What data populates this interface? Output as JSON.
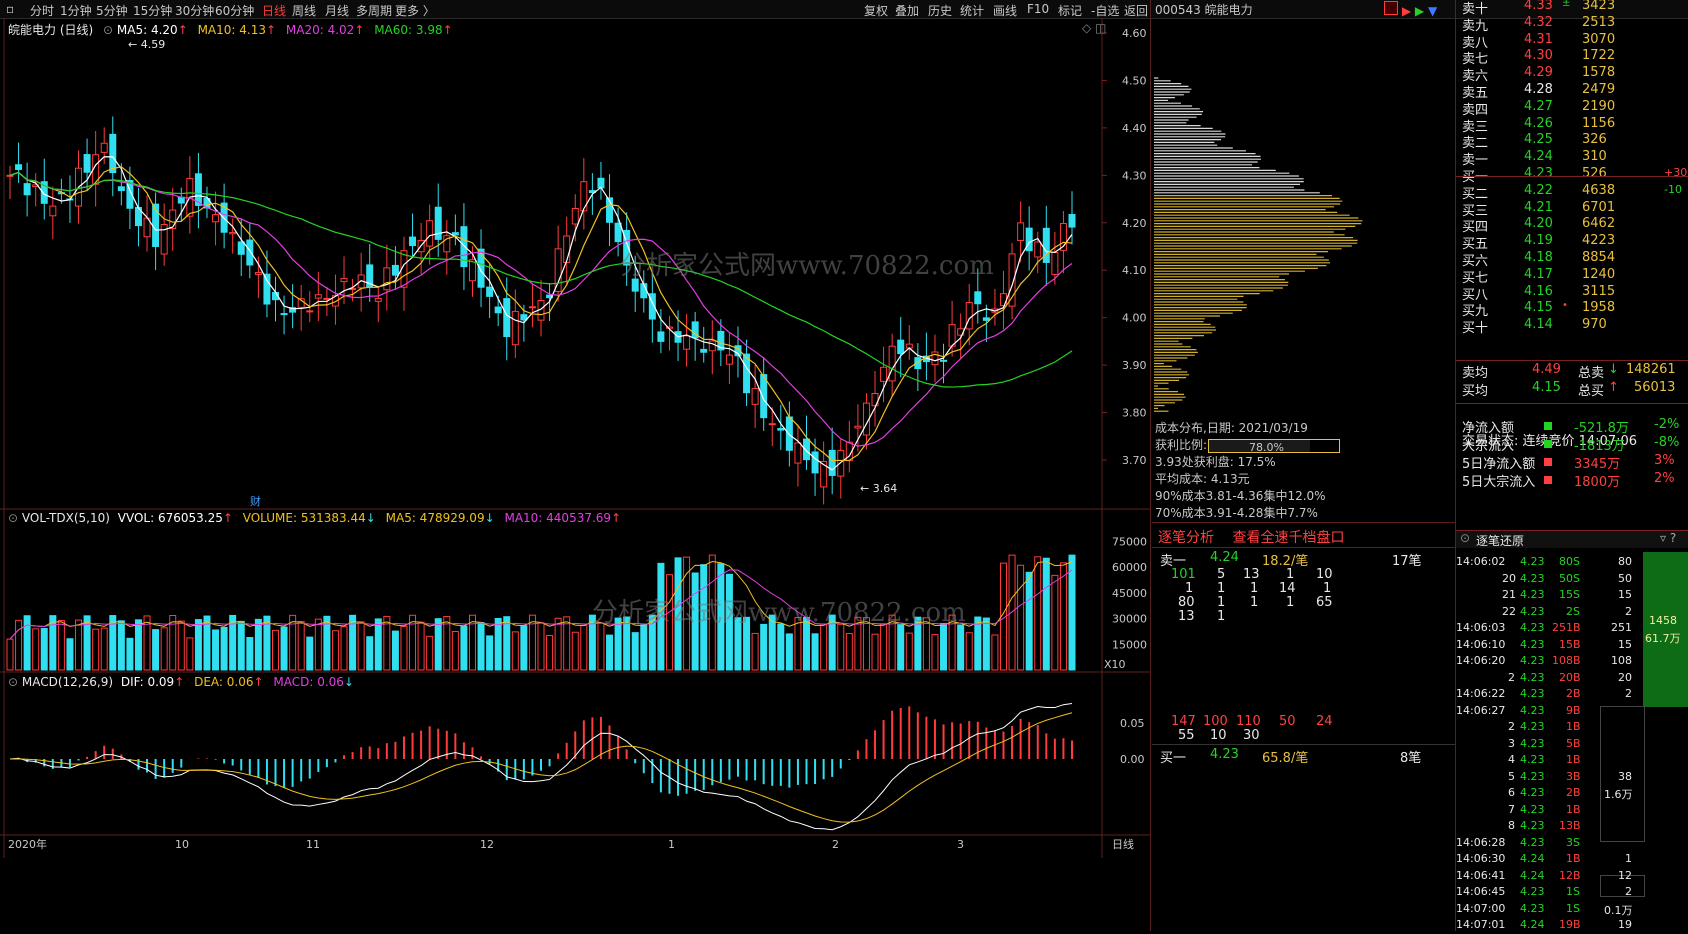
{
  "toolbar": {
    "periods": [
      "分时",
      "1分钟",
      "5分钟",
      "15分钟",
      "30分钟",
      "60分钟",
      "日线",
      "周线",
      "月线",
      "多周期",
      "更多 〉"
    ],
    "active_period": "日线",
    "right_items": [
      "复权",
      "叠加",
      "历史",
      "统计",
      "画线",
      "F10",
      "标记",
      "-自选",
      "返回"
    ]
  },
  "stock": {
    "code": "000543",
    "name": "皖能电力",
    "title": "皖能电力 (日线)"
  },
  "main_indicators": {
    "ma5": "MA5: 4.20",
    "ma10": "MA10: 4.13",
    "ma20": "MA20: 4.02",
    "ma60": "MA60: 3.98",
    "colors": {
      "ma5": "#ffffff",
      "ma10": "#f0c020",
      "ma20": "#e040e0",
      "ma60": "#24d324"
    }
  },
  "price_axis": [
    "4.60",
    "4.50",
    "4.40",
    "4.30",
    "4.20",
    "4.10",
    "4.00",
    "3.90",
    "3.80",
    "3.70"
  ],
  "price_annotations": {
    "high": "4.59",
    "low": "3.64",
    "finance_mark": "财"
  },
  "volume_indicators": {
    "name": "VOL-TDX(5,10)",
    "vvol": "VVOL: 676053.25",
    "volume": "VOLUME: 531383.44",
    "ma5": "MA5: 478929.09",
    "ma10": "MA10: 440537.69"
  },
  "volume_axis": [
    "75000",
    "60000",
    "45000",
    "30000",
    "15000"
  ],
  "volume_unit": "X10",
  "macd_indicators": {
    "name": "MACD(12,26,9)",
    "dif": "DIF: 0.09",
    "dea": "DEA: 0.06",
    "macd": "MACD: 0.06"
  },
  "macd_axis": [
    "0.05",
    "0.00"
  ],
  "date_axis": [
    "2020年",
    "10",
    "11",
    "12",
    "1",
    "2",
    "3"
  ],
  "period_label": "日线",
  "watermark": "分析家公式网www.70822.com",
  "chip": {
    "date_line": "成本分布,日期: 2021/03/19",
    "profit_label": "获利比例:",
    "profit_value": "78.0%",
    "profit_ratio": 0.78,
    "line2": "3.93处获利盘: 17.5%",
    "line3": "平均成本: 4.13元",
    "line4": "90%成本3.81-4.36集中12.0%",
    "line5": "70%成本3.91-4.28集中7.7%"
  },
  "order_book": {
    "sells": [
      {
        "label": "卖十",
        "price": "4.33",
        "vol": "3423",
        "mark": "±"
      },
      {
        "label": "卖九",
        "price": "4.32",
        "vol": "2513"
      },
      {
        "label": "卖八",
        "price": "4.31",
        "vol": "3070"
      },
      {
        "label": "卖七",
        "price": "4.30",
        "vol": "1722"
      },
      {
        "label": "卖六",
        "price": "4.29",
        "vol": "1578"
      },
      {
        "label": "卖五",
        "price": "4.28",
        "vol": "2479"
      },
      {
        "label": "卖四",
        "price": "4.27",
        "vol": "2190"
      },
      {
        "label": "卖三",
        "price": "4.26",
        "vol": "1156"
      },
      {
        "label": "卖二",
        "price": "4.25",
        "vol": "326"
      },
      {
        "label": "卖一",
        "price": "4.24",
        "vol": "310"
      }
    ],
    "buys": [
      {
        "label": "买一",
        "price": "4.23",
        "vol": "526",
        "chg": "+30"
      },
      {
        "label": "买二",
        "price": "4.22",
        "vol": "4638",
        "chg": "-10"
      },
      {
        "label": "买三",
        "price": "4.21",
        "vol": "6701"
      },
      {
        "label": "买四",
        "price": "4.20",
        "vol": "6462"
      },
      {
        "label": "买五",
        "price": "4.19",
        "vol": "4223"
      },
      {
        "label": "买六",
        "price": "4.18",
        "vol": "8854"
      },
      {
        "label": "买七",
        "price": "4.17",
        "vol": "1240"
      },
      {
        "label": "买八",
        "price": "4.16",
        "vol": "3115"
      },
      {
        "label": "买九",
        "price": "4.15",
        "vol": "1958",
        "mark": "•"
      },
      {
        "label": "买十",
        "price": "4.14",
        "vol": "970"
      }
    ],
    "sell_avg": {
      "label": "卖均",
      "price": "4.49",
      "total_label": "总卖",
      "total": "148261"
    },
    "buy_avg": {
      "label": "买均",
      "price": "4.15",
      "total_label": "总买",
      "total": "56013"
    }
  },
  "trade_status": {
    "label": "交易状态: 连续竞价 14:07:06"
  },
  "flows": [
    {
      "label": "净流入额",
      "value": "-521.8万",
      "pct": "-2%",
      "color": "green"
    },
    {
      "label": "大宗流入",
      "value": "-1813万",
      "pct": "-8%",
      "color": "green"
    },
    {
      "label": "5日净流入额",
      "value": "3345万",
      "pct": "3%",
      "color": "red"
    },
    {
      "label": "5日大宗流入",
      "value": "1800万",
      "pct": "2%",
      "color": "red"
    }
  ],
  "tick_analysis": {
    "title": "逐笔分析",
    "link": "查看全速千档盘口",
    "sell1": {
      "label": "卖一",
      "price": "4.24",
      "per": "18.2/笔",
      "count": "17笔"
    },
    "sell_queue": [
      [
        "101",
        "5",
        "13",
        "1",
        "10"
      ],
      [
        "1",
        "1",
        "1",
        "14",
        "1"
      ],
      [
        "80",
        "1",
        "1",
        "1",
        "65"
      ],
      [
        "13",
        "1"
      ]
    ],
    "buy1": {
      "label": "买一",
      "price": "4.23",
      "per": "65.8/笔",
      "count": "8笔"
    },
    "buy_queue": [
      [
        "147",
        "100",
        "110",
        "50",
        "24"
      ],
      [
        "55",
        "10",
        "30"
      ]
    ]
  },
  "tick_replay": {
    "title": "逐笔还原",
    "rows": [
      {
        "t": "14:06:02",
        "p": "4.23",
        "v": "80S",
        "r": "80"
      },
      {
        "t": "20",
        "p": "4.23",
        "v": "50S",
        "r": "50"
      },
      {
        "t": "21",
        "p": "4.23",
        "v": "15S",
        "r": "15"
      },
      {
        "t": "22",
        "p": "4.23",
        "v": "2S",
        "r": "2"
      },
      {
        "t": "14:06:03",
        "p": "4.23",
        "v": "251B",
        "r": "251"
      },
      {
        "t": "14:06:10",
        "p": "4.23",
        "v": "15B",
        "r": "15"
      },
      {
        "t": "14:06:20",
        "p": "4.23",
        "v": "108B",
        "r": "108"
      },
      {
        "t": "2",
        "p": "4.23",
        "v": "20B",
        "r": "20"
      },
      {
        "t": "14:06:22",
        "p": "4.23",
        "v": "2B",
        "r": "2"
      },
      {
        "t": "14:06:27",
        "p": "4.23",
        "v": "9B",
        "r": ""
      },
      {
        "t": "2",
        "p": "4.23",
        "v": "1B",
        "r": ""
      },
      {
        "t": "3",
        "p": "4.23",
        "v": "5B",
        "r": ""
      },
      {
        "t": "4",
        "p": "4.23",
        "v": "1B",
        "r": ""
      },
      {
        "t": "5",
        "p": "4.23",
        "v": "3B",
        "r": "38"
      },
      {
        "t": "6",
        "p": "4.23",
        "v": "2B",
        "r": "1.6万"
      },
      {
        "t": "7",
        "p": "4.23",
        "v": "1B",
        "r": ""
      },
      {
        "t": "8",
        "p": "4.23",
        "v": "13B",
        "r": ""
      },
      {
        "t": "14:06:28",
        "p": "4.23",
        "v": "3S",
        "r": ""
      },
      {
        "t": "14:06:30",
        "p": "4.24",
        "v": "1B",
        "r": "1"
      },
      {
        "t": "14:06:41",
        "p": "4.24",
        "v": "12B",
        "r": "12"
      },
      {
        "t": "14:06:45",
        "p": "4.23",
        "v": "1S",
        "r": "2"
      },
      {
        "t": "14:07:00",
        "p": "4.23",
        "v": "1S",
        "r": "0.1万"
      },
      {
        "t": "14:07:01",
        "p": "4.24",
        "v": "19B",
        "r": "19"
      }
    ],
    "side_big": "1458",
    "side_big2": "61.7万"
  }
}
